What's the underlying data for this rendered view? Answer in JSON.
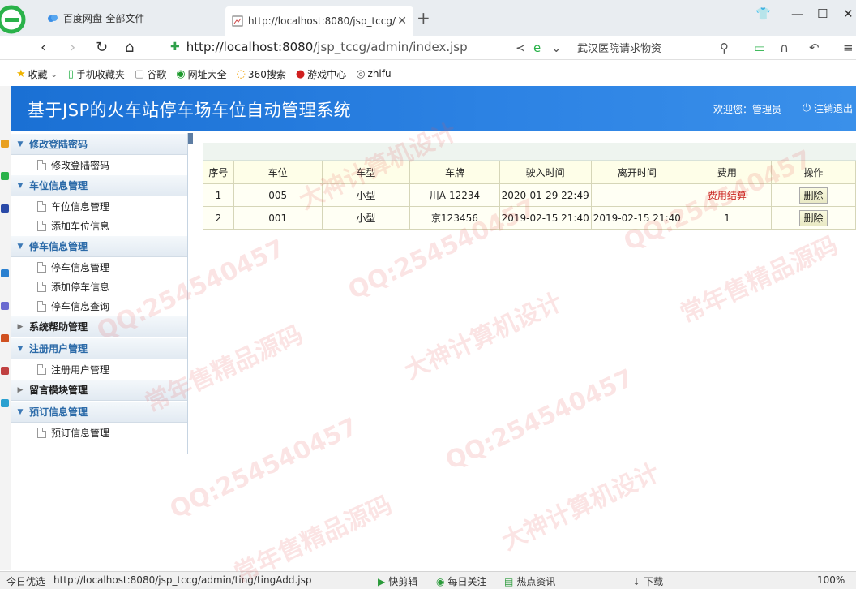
{
  "browser": {
    "tabs": [
      {
        "label": "百度网盘-全部文件"
      },
      {
        "label": "http://localhost:8080/jsp_tccg/"
      }
    ],
    "url_host": "http://localhost:8080",
    "url_path": "/jsp_tccg/admin/index.jsp",
    "search_text": "武汉医院请求物资",
    "bookmarks": [
      "收藏",
      "手机收藏夹",
      "谷歌",
      "网址大全",
      "360搜索",
      "游戏中心",
      "zhifu"
    ]
  },
  "header": {
    "title": "基于JSP的火车站停车场车位自动管理系统",
    "welcome": "欢迎您：管理员",
    "logout": "注销退出"
  },
  "sidebar": {
    "groups": [
      {
        "label": "修改登陆密码",
        "items": [
          "修改登陆密码"
        ]
      },
      {
        "label": "车位信息管理",
        "items": [
          "车位信息管理",
          "添加车位信息"
        ]
      },
      {
        "label": "停车信息管理",
        "items": [
          "停车信息管理",
          "添加停车信息",
          "停车信息查询"
        ]
      },
      {
        "label": "系统帮助管理",
        "items": []
      },
      {
        "label": "注册用户管理",
        "items": [
          "注册用户管理"
        ]
      },
      {
        "label": "留言模块管理",
        "items": []
      },
      {
        "label": "预订信息管理",
        "items": [
          "预订信息管理"
        ]
      }
    ]
  },
  "table": {
    "headers": [
      "序号",
      "车位",
      "车型",
      "车牌",
      "驶入时间",
      "离开时间",
      "费用",
      "操作"
    ],
    "rows": [
      {
        "no": "1",
        "space": "005",
        "type": "小型",
        "plate": "川A-12234",
        "in_time": "2020-01-29 22:49",
        "out_time": "",
        "fee": "费用结算",
        "action": "删除"
      },
      {
        "no": "2",
        "space": "001",
        "type": "小型",
        "plate": "京123456",
        "in_time": "2019-02-15 21:40",
        "out_time": "2019-02-15 21:40",
        "fee": "1",
        "action": "删除"
      }
    ]
  },
  "statusbar": {
    "left": "今日优选",
    "url": "http://localhost:8080/jsp_tccg/admin/ting/tingAdd.jsp",
    "items": [
      "快剪辑",
      "每日关注",
      "热点资讯",
      "下载"
    ],
    "zoom": "100%"
  },
  "watermark": {
    "texts": [
      "QQ:254540457",
      "常年售精品源码",
      "大神计算机设计"
    ]
  },
  "colors": {
    "header_blue": "#2a7ee0",
    "menu_text_blue": "#2b6aa8",
    "fee_red": "#c8201a"
  }
}
